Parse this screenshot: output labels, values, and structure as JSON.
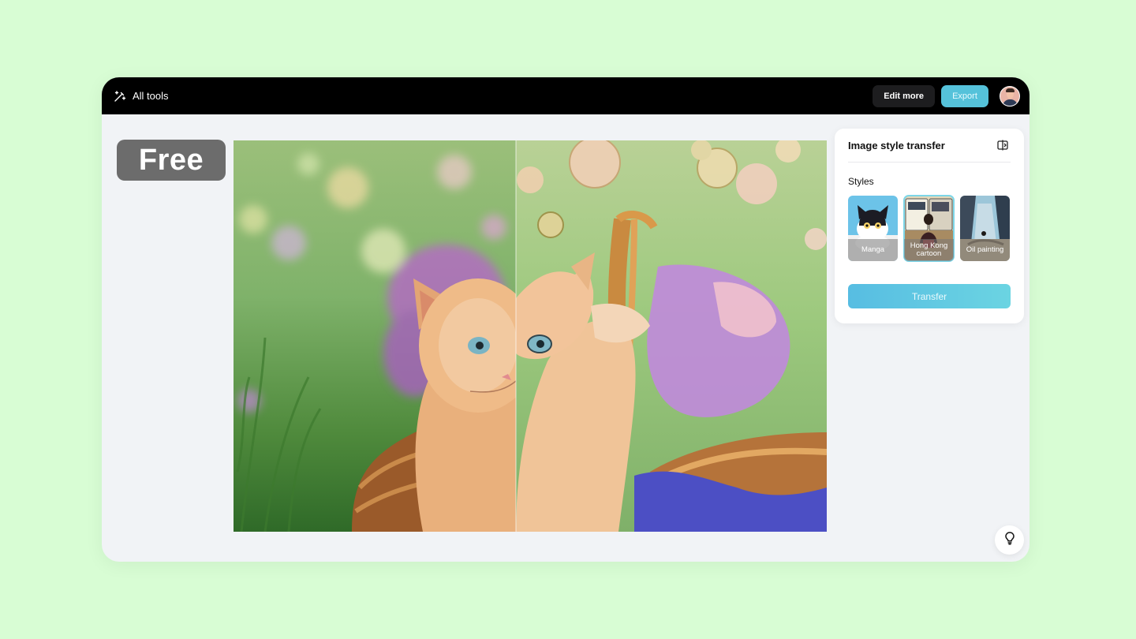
{
  "toolbar": {
    "all_tools_label": "All tools",
    "edit_more_label": "Edit more",
    "export_label": "Export"
  },
  "badge": {
    "free_label": "Free"
  },
  "panel": {
    "title": "Image style transfer",
    "styles_heading": "Styles",
    "styles": [
      {
        "label": "Manga",
        "selected": false
      },
      {
        "label": "Hong Kong cartoon",
        "selected": true
      },
      {
        "label": "Oil painting",
        "selected": false
      }
    ],
    "transfer_label": "Transfer"
  },
  "colors": {
    "background": "#d8fdd4",
    "accent": "#55c2da",
    "topbar": "#000000"
  },
  "icons": {
    "all_tools": "magic-wand-icon",
    "compare": "compare-icon",
    "tip": "lightbulb-icon"
  }
}
